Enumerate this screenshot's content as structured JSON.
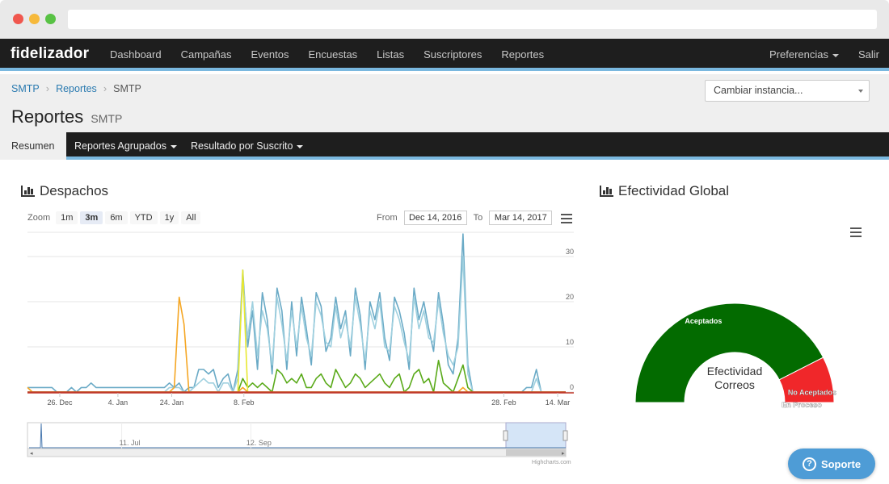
{
  "browser": {
    "url": ""
  },
  "nav": {
    "brand": "fidelizador",
    "items": [
      "Dashboard",
      "Campañas",
      "Eventos",
      "Encuestas",
      "Listas",
      "Suscriptores",
      "Reportes"
    ],
    "right": {
      "preferences": "Preferencias",
      "logout": "Salir"
    }
  },
  "breadcrumb": {
    "items": [
      "SMTP",
      "Reportes"
    ],
    "current": "SMTP"
  },
  "instance_select": {
    "value": "Cambiar instancia..."
  },
  "page": {
    "title": "Reportes",
    "subtitle": "SMTP"
  },
  "tabs": {
    "summary": "Resumen",
    "grouped": "Reportes Agrupados",
    "by_subscriber": "Resultado por Suscrito"
  },
  "despachos": {
    "title": "Despachos",
    "zoom_label": "Zoom",
    "zoom_options": [
      "1m",
      "3m",
      "6m",
      "YTD",
      "1y",
      "All"
    ],
    "zoom_selected": "3m",
    "from_label": "From",
    "from_value": "Dec 14, 2016",
    "to_label": "To",
    "to_value": "Mar 14, 2017",
    "credits": "Highcharts.com"
  },
  "efectividad": {
    "title": "Efectividad Global"
  },
  "support": {
    "label": "Soporte",
    "icon": "question-circle-icon"
  },
  "colors": {
    "nav_bg": "#1e1e1e",
    "accent": "#7ab8df",
    "link": "#2a7ab0",
    "series_blue": "#6aaac6",
    "series_lightblue": "#9fd0df",
    "series_green": "#5aaa1a",
    "series_orange": "#f5a623",
    "series_yellow": "#e8e830",
    "series_red": "#c0392b",
    "gauge_green": "#036b00",
    "gauge_red": "#f0272a"
  },
  "chart_data": [
    {
      "type": "line",
      "title": "",
      "x_tick_labels": [
        "26. Dec",
        "4. Jan",
        "24. Jan",
        "8. Feb",
        "28. Feb",
        "14. Mar"
      ],
      "x_range": [
        "Dec 14, 2016",
        "Mar 14, 2017"
      ],
      "y_tick_labels": [
        "0",
        "10",
        "20",
        "30"
      ],
      "ylim": [
        0,
        35
      ],
      "grid": true,
      "legend": "none",
      "series": [
        {
          "color": "#6aaac6",
          "values": [
            1,
            1,
            1,
            1,
            1,
            1,
            0,
            0,
            0,
            1,
            0,
            1,
            1,
            2,
            1,
            1,
            1,
            1,
            1,
            1,
            1,
            1,
            1,
            1,
            1,
            1,
            1,
            1,
            1,
            2,
            1,
            2,
            0,
            1,
            1,
            5,
            5,
            4,
            5,
            1,
            3,
            4,
            0,
            5,
            27,
            10,
            18,
            5,
            22,
            16,
            4,
            23,
            18,
            5,
            20,
            8,
            21,
            14,
            6,
            22,
            19,
            9,
            12,
            21,
            14,
            18,
            8,
            23,
            17,
            5,
            20,
            16,
            22,
            12,
            7,
            21,
            18,
            13,
            5,
            23,
            16,
            20,
            14,
            9,
            22,
            15,
            6,
            4,
            12,
            35,
            6,
            0,
            0,
            0,
            0,
            0,
            0,
            0,
            0,
            0,
            0,
            0,
            1,
            1,
            5,
            0,
            0,
            0,
            0,
            0,
            0
          ]
        },
        {
          "color": "#9fd0df",
          "values": [
            0,
            0,
            0,
            0,
            0,
            0,
            0,
            0,
            0,
            0,
            0,
            0,
            0,
            0,
            0,
            0,
            0,
            0,
            0,
            0,
            0,
            0,
            0,
            0,
            0,
            0,
            0,
            0,
            0,
            1,
            1,
            1,
            0,
            0,
            1,
            2,
            3,
            2,
            2,
            0,
            2,
            2,
            0,
            3,
            25,
            12,
            20,
            8,
            18,
            14,
            6,
            21,
            15,
            7,
            18,
            10,
            19,
            12,
            8,
            20,
            17,
            11,
            10,
            19,
            12,
            16,
            10,
            21,
            15,
            7,
            18,
            14,
            20,
            10,
            9,
            19,
            16,
            11,
            7,
            21,
            14,
            18,
            12,
            11,
            20,
            13,
            8,
            6,
            10,
            30,
            4,
            0,
            0,
            0,
            0,
            0,
            0,
            0,
            0,
            0,
            0,
            0,
            0,
            0,
            3,
            0,
            0,
            0,
            0,
            0,
            0
          ]
        },
        {
          "color": "#5aaa1a",
          "values": [
            0,
            0,
            0,
            0,
            0,
            0,
            0,
            0,
            0,
            0,
            0,
            0,
            0,
            0,
            0,
            0,
            0,
            0,
            0,
            0,
            0,
            0,
            0,
            0,
            0,
            0,
            0,
            0,
            0,
            0,
            0,
            0,
            0,
            0,
            0,
            0,
            0,
            0,
            0,
            0,
            0,
            0,
            0,
            0,
            3,
            1,
            2,
            1,
            2,
            1,
            0,
            5,
            4,
            2,
            3,
            2,
            4,
            1,
            1,
            3,
            4,
            2,
            1,
            5,
            3,
            1,
            2,
            4,
            3,
            1,
            2,
            3,
            4,
            2,
            1,
            3,
            4,
            0,
            1,
            4,
            5,
            2,
            3,
            0,
            7,
            2,
            1,
            0,
            3,
            6,
            1,
            0,
            0,
            0,
            0,
            0,
            0,
            0,
            0,
            0,
            0,
            0,
            0,
            0,
            0,
            0,
            0,
            0,
            0,
            0,
            0
          ]
        },
        {
          "color": "#f5a623",
          "values": [
            1,
            0,
            0,
            0,
            0,
            0,
            0,
            0,
            0,
            0,
            0,
            0,
            0,
            0,
            0,
            0,
            0,
            0,
            0,
            0,
            0,
            0,
            0,
            0,
            0,
            0,
            0,
            0,
            0,
            0,
            1,
            21,
            15,
            0,
            0,
            0,
            0,
            0,
            0,
            0,
            0,
            0,
            0,
            0,
            1,
            0,
            0,
            0,
            0,
            0,
            0,
            0,
            0,
            0,
            0,
            0,
            0,
            0,
            0,
            0,
            0,
            0,
            0,
            0,
            0,
            0,
            0,
            0,
            0,
            0,
            0,
            0,
            0,
            0,
            0,
            0,
            0,
            0,
            0,
            0,
            0,
            0,
            0,
            0,
            0,
            0,
            0,
            0,
            0,
            1,
            0,
            0,
            0,
            0,
            0,
            0,
            0,
            0,
            0,
            0,
            0,
            0,
            0,
            0,
            0,
            0,
            0,
            0,
            0,
            0,
            0
          ]
        },
        {
          "color": "#e8e830",
          "values": [
            0,
            0,
            0,
            0,
            0,
            0,
            0,
            0,
            0,
            0,
            0,
            0,
            0,
            0,
            0,
            0,
            0,
            0,
            0,
            0,
            0,
            0,
            0,
            0,
            0,
            0,
            0,
            0,
            0,
            0,
            0,
            0,
            0,
            0,
            0,
            0,
            0,
            0,
            0,
            0,
            0,
            0,
            0,
            0,
            27,
            0,
            0,
            0,
            0,
            0,
            0,
            0,
            0,
            0,
            0,
            0,
            0,
            0,
            0,
            0,
            0,
            0,
            0,
            0,
            0,
            0,
            0,
            0,
            0,
            0,
            0,
            0,
            0,
            0,
            0,
            0,
            0,
            0,
            0,
            0,
            0,
            0,
            0,
            0,
            0,
            0,
            0,
            0,
            0,
            0,
            0,
            0,
            0,
            0,
            0,
            0,
            0,
            0,
            0,
            0,
            0,
            0,
            0,
            0,
            0,
            0,
            0,
            0,
            0,
            0,
            0
          ]
        },
        {
          "color": "#c0392b",
          "values": [
            0,
            0,
            0,
            0,
            0,
            0,
            0,
            0,
            0,
            0,
            0,
            0,
            0,
            0,
            0,
            0,
            0,
            0,
            0,
            0,
            0,
            0,
            0,
            0,
            0,
            0,
            0,
            0,
            0,
            0,
            0,
            0,
            0,
            0,
            0,
            0,
            0,
            0,
            0,
            0,
            0,
            0,
            0,
            0,
            0,
            0,
            0,
            0,
            0,
            0,
            0,
            0,
            0,
            0,
            0,
            0,
            0,
            0,
            0,
            0,
            0,
            0,
            0,
            0,
            0,
            0,
            0,
            0,
            0,
            0,
            0,
            0,
            0,
            0,
            0,
            0,
            0,
            0,
            0,
            0,
            0,
            0,
            0,
            0,
            0,
            0,
            0,
            0,
            0,
            0,
            0,
            0,
            0,
            0,
            0,
            0,
            0,
            0,
            0,
            0,
            0,
            0,
            0,
            0,
            0,
            0,
            0,
            0,
            0,
            0,
            0
          ]
        }
      ],
      "navigator": {
        "x_tick_labels": [
          "11. Jul",
          "12. Sep"
        ]
      }
    },
    {
      "type": "pie",
      "variant": "semi-circle donut",
      "title": "Efectividad Correos",
      "slices": [
        {
          "name": "Aceptados",
          "value": 85,
          "color": "#036b00"
        },
        {
          "name": "No Aceptados",
          "value": 15,
          "color": "#f0272a"
        },
        {
          "name": "En Proceso",
          "value": 0,
          "color": "#999999"
        }
      ]
    }
  ]
}
